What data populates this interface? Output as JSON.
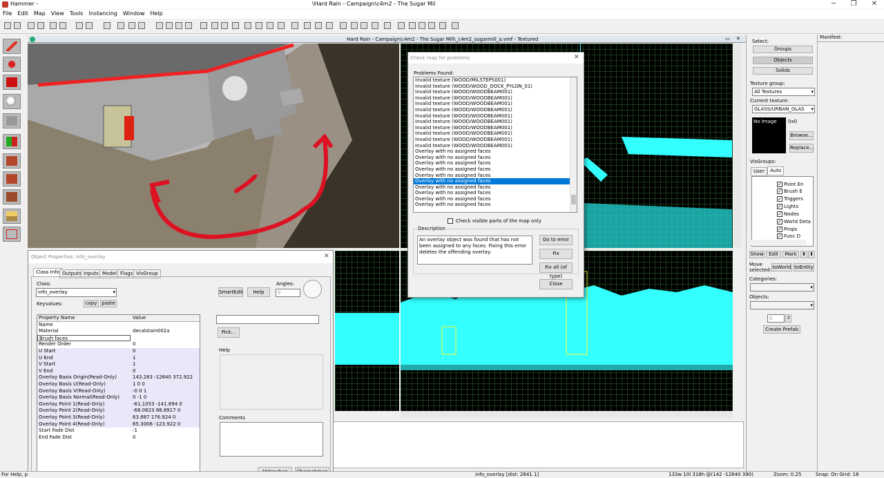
{
  "app": {
    "title": "Hammer -",
    "window_title": "\\Hard Rain - Campaign\\c4m2 - The Sugar Mil"
  },
  "menu": [
    "File",
    "Edit",
    "Map",
    "View",
    "Tools",
    "Instancing",
    "Window",
    "Help"
  ],
  "viewport": {
    "title": "Hard Rain - Campaign\\c4m2 - The Sugar Mill\\_c4m2_sugarmill_a.vmf - Textured"
  },
  "check_dialog": {
    "title": "Check map for problems",
    "problems_label": "Problems Found:",
    "problems": [
      "Invalid texture (WOOD/MILSTEPS001)",
      "Invalid texture (WOOD/WOOD_DOCK_PYLON_01)",
      "Invalid texture (WOOD/WOODBEAM001)",
      "Invalid texture (WOOD/WOODBEAM001)",
      "Invalid texture (WOOD/WOODBEAM001)",
      "Invalid texture (WOOD/WOODBEAM001)",
      "Invalid texture (WOOD/WOODBEAM001)",
      "Invalid texture (WOOD/WOODBEAM001)",
      "Invalid texture (WOOD/WOODBEAM001)",
      "Invalid texture (WOOD/WOODBEAM001)",
      "Invalid texture (WOOD/WOODBEAM001)",
      "Invalid texture (WOOD/WOODBEAM001)",
      "Overlay with no assigned faces",
      "Overlay with no assigned faces",
      "Overlay with no assigned faces",
      "Overlay with no assigned faces",
      "Overlay with no assigned faces",
      "Overlay with no assigned faces",
      "Overlay with no assigned faces",
      "Overlay with no assigned faces",
      "Overlay with no assigned faces",
      "Overlay with no assigned faces"
    ],
    "selected_index": 17,
    "check_visible": "Check visible parts of the map only",
    "description_label": "Description",
    "description": "An overlay object was found that has not been assigned to any faces.  Fixing this error deletes the offending overlay.",
    "go_to_error": "Go to error",
    "fix": "Fix",
    "fix_all": "Fix all (of type)",
    "close": "Close"
  },
  "obj_props": {
    "title": "Object Properties: info_overlay",
    "tabs": [
      "Class Info",
      "Outputs",
      "Inputs",
      "Model",
      "Flags",
      "VisGroup"
    ],
    "class_label": "Class:",
    "class_value": "info_overlay",
    "keyvalues_label": "Keyvalues:",
    "copy": "copy",
    "paste": "paste",
    "smartedit": "SmartEdit",
    "help_btn": "Help",
    "angles_label": "Angles:",
    "angles_value": "0",
    "col_name": "Property Name",
    "col_value": "Value",
    "rows": [
      {
        "k": "Name",
        "v": ""
      },
      {
        "k": "Material",
        "v": "decalstain002a"
      },
      {
        "k": "Brush faces",
        "v": ""
      },
      {
        "k": "Render Order",
        "v": "0"
      },
      {
        "k": "U Start",
        "v": "0"
      },
      {
        "k": "U End",
        "v": "1"
      },
      {
        "k": "V Start",
        "v": "1"
      },
      {
        "k": "V End",
        "v": "0"
      },
      {
        "k": "Overlay Basis Origin(Read-Only)",
        "v": "143.283 -12640 372.922"
      },
      {
        "k": "Overlay Basis U(Read-Only)",
        "v": "1 0 0"
      },
      {
        "k": "Overlay Basis V(Read-Only)",
        "v": "-0 0 1"
      },
      {
        "k": "Overlay Basis Normal(Read-Only)",
        "v": "0 -1 0"
      },
      {
        "k": "Overlay Point 1(Read-Only)",
        "v": "-61.1053 -141.894 0"
      },
      {
        "k": "Overlay Point 2(Read-Only)",
        "v": "-68.0823 88.8917 0"
      },
      {
        "k": "Overlay Point 3(Read-Only)",
        "v": "63.887 176.924 0"
      },
      {
        "k": "Overlay Point 4(Read-Only)",
        "v": "65.3006 -123.922 0"
      },
      {
        "k": "Start Fade Dist",
        "v": "-1"
      },
      {
        "k": "End Fade Dist",
        "v": "0"
      }
    ],
    "pick": "Pick...",
    "help_label": "Help",
    "comments_label": "Comments",
    "abbrechen": "Abbrechen",
    "ubernehmen": "Übernehmen"
  },
  "right_panel": {
    "select_label": "Select:",
    "groups": "Groups",
    "objects": "Objects",
    "solids": "Solids",
    "texture_group_label": "Texture group:",
    "texture_group": "All Textures",
    "current_texture_label": "Current texture:",
    "current_texture": "GLASS/URBAN_GLAS",
    "no_image": "No Image",
    "size": "0x0",
    "browse": "Browse...",
    "replace": "Replace...",
    "visgroups_label": "VisGroups:",
    "user_tab": "User",
    "auto_tab": "Auto",
    "visgroups": [
      "Point En",
      "Brush E",
      "Triggers",
      "Lights",
      "Nodes",
      "World Deta",
      "Props",
      "Func D"
    ],
    "show": "Show",
    "edit": "Edit",
    "mark": "Mark",
    "move_selected": "Move selected:",
    "to_world": "toWorld",
    "to_entity": "toEntity",
    "categories_label": "Categories:",
    "objects_label": "Objects:",
    "spinner_value": "0",
    "create_prefab": "Create Prefab",
    "manifest": "Manifest:"
  },
  "status": {
    "help": "For Help, p",
    "entity": "info_overlay   [dist: 2641.1]",
    "coords": "133w 10l 318h @(142 -12640 390)",
    "zoom": "Zoom: 0.25",
    "snap": "Snap: On Grid: 16"
  }
}
